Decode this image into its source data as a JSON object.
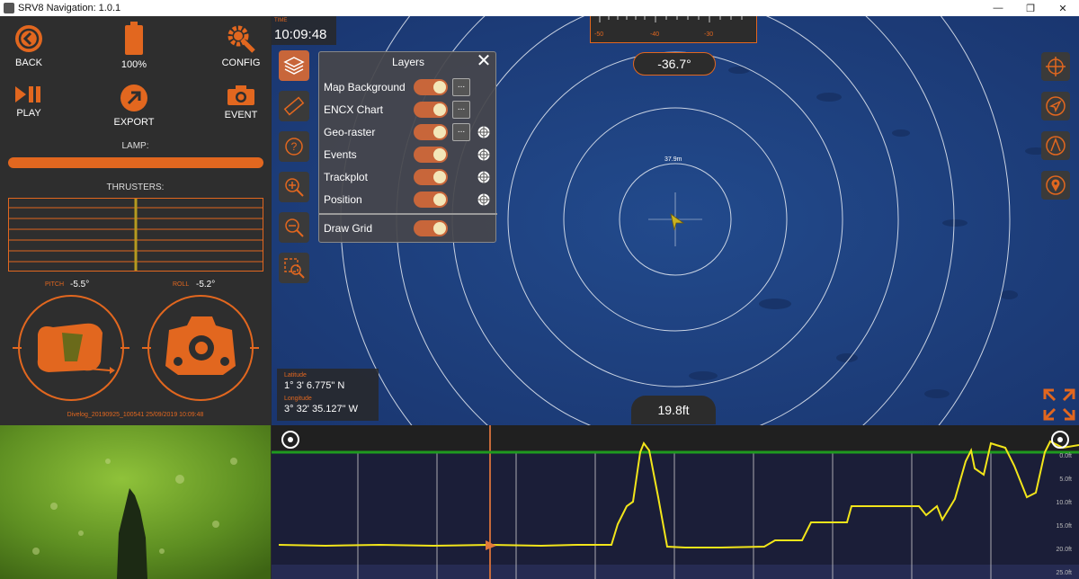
{
  "window": {
    "title": "SRV8 Navigation: 1.0.1",
    "minimize": "—",
    "maximize": "❐",
    "close": "✕"
  },
  "left_panel": {
    "back_label": "BACK",
    "battery_label": "100%",
    "config_label": "CONFIG",
    "play_label": "PLAY",
    "export_label": "EXPORT",
    "event_label": "EVENT",
    "lamp_label": "LAMP:",
    "lamp_level": 1.0,
    "thrusters_label": "THRUSTERS:",
    "pitch_label": "PITCH",
    "pitch_value": "-5.5°",
    "roll_label": "ROLL",
    "roll_value": "-5.2°",
    "divelog": "Divelog_20190925_100541 25/09/2019 10:09:48"
  },
  "map": {
    "time_label": "TIME",
    "time_value": "10:09:48",
    "heading_value": "-36.7°",
    "compass_ticks": [
      "-50",
      "-40",
      "-30"
    ],
    "ring_label": "37.9m",
    "depth_value": "19.8ft",
    "latitude_label": "Latitude",
    "latitude_value": "1° 3' 6.775\" N",
    "longitude_label": "Longitude",
    "longitude_value": "3° 32' 35.127\" W"
  },
  "layers_panel": {
    "title": "Layers",
    "close_label": "✕",
    "more_label": "...",
    "rows": [
      {
        "name": "Map Background",
        "enabled": true
      },
      {
        "name": "ENCX Chart",
        "enabled": true
      },
      {
        "name": "Geo-raster",
        "enabled": true
      },
      {
        "name": "Events",
        "enabled": true
      },
      {
        "name": "Trackplot",
        "enabled": true
      },
      {
        "name": "Position",
        "enabled": true
      },
      {
        "name": "Draw Grid",
        "enabled": true
      }
    ]
  },
  "sonar": {
    "depth_ticks": [
      "0.0ft",
      "5.0ft",
      "10.0ft",
      "15.0ft",
      "20.0ft",
      "25.0ft"
    ]
  },
  "colors": {
    "accent": "#e2671f",
    "map_water": "#1d3d78",
    "trace": "#f2e51a",
    "surface_line": "#1f9a1f"
  }
}
